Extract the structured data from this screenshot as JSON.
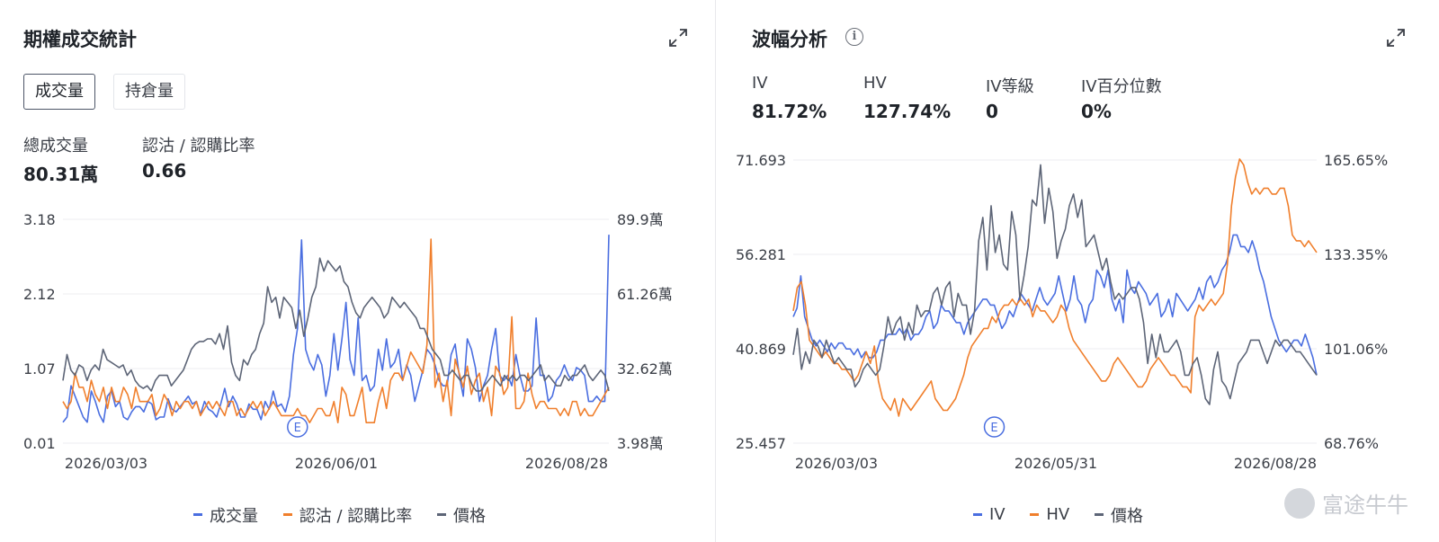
{
  "left": {
    "title": "期權成交統計",
    "tabs": [
      {
        "label": "成交量",
        "active": true
      },
      {
        "label": "持倉量",
        "active": false
      }
    ],
    "stats": [
      {
        "label": "總成交量",
        "value": "80.31萬"
      },
      {
        "label": "認沽 / 認購比率",
        "value": "0.66"
      }
    ],
    "icons": {
      "expand": "expand-icon"
    }
  },
  "right": {
    "title": "波幅分析",
    "icons": {
      "info": "info-icon",
      "expand": "expand-icon"
    },
    "info_glyph": "i",
    "stats": [
      {
        "label": "IV",
        "value": "81.72%"
      },
      {
        "label": "HV",
        "value": "127.74%"
      },
      {
        "label": "IV等級",
        "value": "0"
      },
      {
        "label": "IV百分位數",
        "value": "0%"
      }
    ]
  },
  "watermark": "富途牛牛",
  "chart_data": [
    {
      "type": "line",
      "left_axis_ticks": [
        "3.18",
        "2.12",
        "1.07",
        "0.01"
      ],
      "right_axis_ticks": [
        "89.9萬",
        "61.26萬",
        "32.62萬",
        "3.98萬"
      ],
      "x_tick_labels": [
        "2026/03/03",
        "2026/06/01",
        "2026/08/28"
      ],
      "left_ylim": [
        0.01,
        3.18
      ],
      "right_ylim": [
        3.98,
        89.9
      ],
      "right_unit": "萬",
      "grid": true,
      "legend_position": "bottom-center",
      "earnings_marker": {
        "label": "E",
        "x_index": 58
      },
      "colors": {
        "volume": "#4a6ee0",
        "put_call": "#f07f2c",
        "price": "#5d6577"
      },
      "series": [
        {
          "name": "成交量",
          "axis": "right",
          "color": "#4a6ee0",
          "values": [
            12,
            14,
            26,
            22,
            18,
            14,
            12,
            24,
            20,
            15,
            12,
            22,
            24,
            18,
            20,
            14,
            13,
            16,
            18,
            18,
            16,
            20,
            19,
            13,
            14,
            14,
            21,
            17,
            16,
            18,
            20,
            22,
            19,
            20,
            15,
            20,
            17,
            16,
            14,
            19,
            25,
            18,
            22,
            19,
            14,
            14,
            19,
            17,
            17,
            13,
            20,
            17,
            24,
            18,
            19,
            16,
            22,
            38,
            48,
            82,
            40,
            35,
            32,
            38,
            34,
            22,
            30,
            46,
            32,
            44,
            58,
            36,
            30,
            52,
            28,
            30,
            24,
            26,
            40,
            32,
            44,
            33,
            35,
            40,
            28,
            34,
            30,
            20,
            26,
            32,
            40,
            38,
            34,
            28,
            26,
            26,
            38,
            42,
            30,
            22,
            44,
            40,
            33,
            20,
            26,
            30,
            40,
            48,
            30,
            28,
            30,
            26,
            38,
            30,
            24,
            24,
            26,
            52,
            30,
            30,
            20,
            22,
            28,
            30,
            34,
            30,
            28,
            33,
            32,
            30,
            20,
            20,
            22,
            20,
            20,
            84
          ]
        },
        {
          "name": "認沽 / 認購比率",
          "axis": "left",
          "color": "#f07f2c",
          "values": [
            0.6,
            0.5,
            0.6,
            1.0,
            0.8,
            0.8,
            0.6,
            0.9,
            0.7,
            0.6,
            0.8,
            0.5,
            0.8,
            0.6,
            0.6,
            0.8,
            0.7,
            0.5,
            0.8,
            0.6,
            0.6,
            0.6,
            0.7,
            0.4,
            0.5,
            0.7,
            0.6,
            0.4,
            0.6,
            0.5,
            0.6,
            0.6,
            0.5,
            0.6,
            0.4,
            0.5,
            0.6,
            0.5,
            0.6,
            0.5,
            0.4,
            0.6,
            0.6,
            0.4,
            0.5,
            0.4,
            0.5,
            0.6,
            0.5,
            0.6,
            0.4,
            0.5,
            0.6,
            0.5,
            0.4,
            0.4,
            0.4,
            0.4,
            0.5,
            0.4,
            0.4,
            0.3,
            0.4,
            0.5,
            0.5,
            0.4,
            0.4,
            0.6,
            0.3,
            0.8,
            0.7,
            0.4,
            0.4,
            0.6,
            0.8,
            0.3,
            0.3,
            0.3,
            0.6,
            0.8,
            0.5,
            0.9,
            1.0,
            1.0,
            0.9,
            1.1,
            1.3,
            1.2,
            1.1,
            1.0,
            1.4,
            2.9,
            0.8,
            1.0,
            0.6,
            0.9,
            0.4,
            1.2,
            1.0,
            0.8,
            1.1,
            0.7,
            0.9,
            1.0,
            0.6,
            0.8,
            0.4,
            1.1,
            1.0,
            0.7,
            0.8,
            1.8,
            0.5,
            0.5,
            0.6,
            1.0,
            0.7,
            0.5,
            0.6,
            0.6,
            0.5,
            0.5,
            0.5,
            0.4,
            0.5,
            0.4,
            0.6,
            0.6,
            0.4,
            0.5,
            0.4,
            0.4,
            0.5,
            0.6,
            0.7,
            0.8
          ]
        },
        {
          "name": "價格",
          "axis": "right",
          "color": "#5d6577",
          "values": [
            28,
            38,
            32,
            30,
            34,
            33,
            28,
            32,
            34,
            32,
            40,
            36,
            35,
            34,
            33,
            34,
            30,
            32,
            28,
            26,
            25,
            26,
            24,
            28,
            30,
            30,
            30,
            26,
            28,
            30,
            32,
            36,
            40,
            42,
            43,
            43,
            44,
            44,
            42,
            46,
            40,
            49,
            35,
            30,
            28,
            36,
            34,
            38,
            40,
            46,
            50,
            64,
            58,
            60,
            52,
            60,
            58,
            56,
            48,
            55,
            45,
            52,
            60,
            64,
            75,
            70,
            74,
            72,
            70,
            72,
            66,
            64,
            58,
            54,
            52,
            56,
            58,
            60,
            58,
            56,
            52,
            54,
            60,
            58,
            56,
            58,
            56,
            54,
            52,
            48,
            48,
            44,
            40,
            38,
            36,
            30,
            30,
            32,
            30,
            28,
            30,
            30,
            26,
            24,
            24,
            26,
            28,
            30,
            28,
            26,
            30,
            28,
            30,
            28,
            30,
            30,
            28,
            30,
            32,
            34,
            28,
            30,
            28,
            26,
            26,
            30,
            28,
            30,
            30,
            32,
            34,
            30,
            28,
            30,
            32,
            30,
            24
          ]
        }
      ]
    },
    {
      "type": "line",
      "left_axis_ticks": [
        "71.693",
        "56.281",
        "40.869",
        "25.457"
      ],
      "right_axis_ticks": [
        "165.65%",
        "133.35%",
        "101.06%",
        "68.76%"
      ],
      "x_tick_labels": [
        "2026/03/03",
        "2026/05/31",
        "2026/08/28"
      ],
      "left_ylim": [
        25.457,
        71.693
      ],
      "right_ylim": [
        68.76,
        165.65
      ],
      "grid": true,
      "legend_position": "bottom-center",
      "earnings_marker": {
        "label": "E",
        "x_index": 53
      },
      "colors": {
        "iv": "#4a6ee0",
        "hv": "#f07f2c",
        "price": "#5d6577"
      },
      "series": [
        {
          "name": "IV",
          "axis": "right",
          "color": "#4a6ee0",
          "values": [
            112,
            115,
            126,
            112,
            108,
            104,
            102,
            104,
            102,
            100,
            103,
            101,
            103,
            103,
            101,
            101,
            99,
            101,
            98,
            100,
            98,
            98,
            100,
            104,
            104,
            106,
            106,
            106,
            108,
            106,
            108,
            104,
            106,
            106,
            108,
            112,
            114,
            108,
            110,
            116,
            114,
            114,
            112,
            110,
            110,
            106,
            110,
            112,
            114,
            116,
            118,
            118,
            116,
            116,
            112,
            108,
            110,
            114,
            112,
            116,
            120,
            118,
            116,
            114,
            118,
            122,
            118,
            116,
            118,
            120,
            126,
            120,
            114,
            118,
            126,
            118,
            116,
            110,
            116,
            118,
            128,
            126,
            122,
            128,
            118,
            114,
            118,
            110,
            128,
            122,
            120,
            124,
            122,
            120,
            116,
            118,
            120,
            112,
            114,
            118,
            112,
            120,
            118,
            116,
            114,
            116,
            118,
            122,
            118,
            124,
            126,
            122,
            124,
            128,
            130,
            134,
            140,
            140,
            136,
            136,
            134,
            138,
            134,
            128,
            124,
            118,
            112,
            108,
            104,
            102,
            100,
            102,
            104,
            104,
            102,
            106,
            102,
            98,
            92
          ]
        },
        {
          "name": "HV",
          "axis": "right",
          "color": "#f07f2c",
          "values": [
            114,
            122,
            124,
            116,
            104,
            102,
            100,
            98,
            100,
            98,
            96,
            96,
            94,
            94,
            92,
            90,
            92,
            96,
            100,
            96,
            102,
            90,
            84,
            82,
            80,
            84,
            78,
            84,
            82,
            80,
            82,
            84,
            86,
            88,
            90,
            84,
            82,
            80,
            80,
            82,
            84,
            88,
            92,
            98,
            102,
            104,
            106,
            108,
            108,
            112,
            110,
            114,
            116,
            116,
            118,
            116,
            118,
            116,
            118,
            112,
            116,
            114,
            114,
            112,
            110,
            112,
            116,
            114,
            108,
            104,
            102,
            100,
            98,
            96,
            94,
            92,
            90,
            90,
            92,
            96,
            98,
            96,
            94,
            92,
            90,
            88,
            88,
            90,
            94,
            96,
            98,
            96,
            94,
            92,
            92,
            90,
            88,
            88,
            86,
            112,
            116,
            114,
            116,
            118,
            116,
            118,
            120,
            130,
            150,
            160,
            166,
            164,
            158,
            154,
            156,
            154,
            156,
            156,
            154,
            154,
            156,
            156,
            150,
            140,
            138,
            138,
            136,
            138,
            136,
            134
          ]
        },
        {
          "name": "價格",
          "axis": "right",
          "color": "#5d6577",
          "values": [
            99,
            108,
            94,
            100,
            96,
            104,
            102,
            98,
            104,
            100,
            96,
            98,
            96,
            94,
            94,
            88,
            90,
            94,
            96,
            94,
            92,
            94,
            102,
            112,
            106,
            110,
            112,
            104,
            110,
            106,
            116,
            112,
            114,
            114,
            120,
            122,
            116,
            122,
            124,
            112,
            120,
            116,
            116,
            106,
            114,
            138,
            146,
            128,
            150,
            134,
            140,
            130,
            128,
            148,
            140,
            118,
            126,
            136,
            152,
            150,
            164,
            144,
            156,
            148,
            132,
            138,
            142,
            150,
            154,
            146,
            152,
            136,
            138,
            140,
            134,
            128,
            132,
            124,
            118,
            120,
            118,
            120,
            122,
            122,
            118,
            110,
            96,
            106,
            98,
            106,
            100,
            100,
            102,
            104,
            100,
            92,
            92,
            96,
            98,
            92,
            84,
            82,
            94,
            100,
            90,
            88,
            84,
            90,
            96,
            98,
            100,
            104,
            104,
            104,
            100,
            96,
            100,
            104,
            102,
            104,
            104,
            102,
            100,
            100,
            98,
            96,
            94,
            92
          ]
        }
      ]
    }
  ]
}
